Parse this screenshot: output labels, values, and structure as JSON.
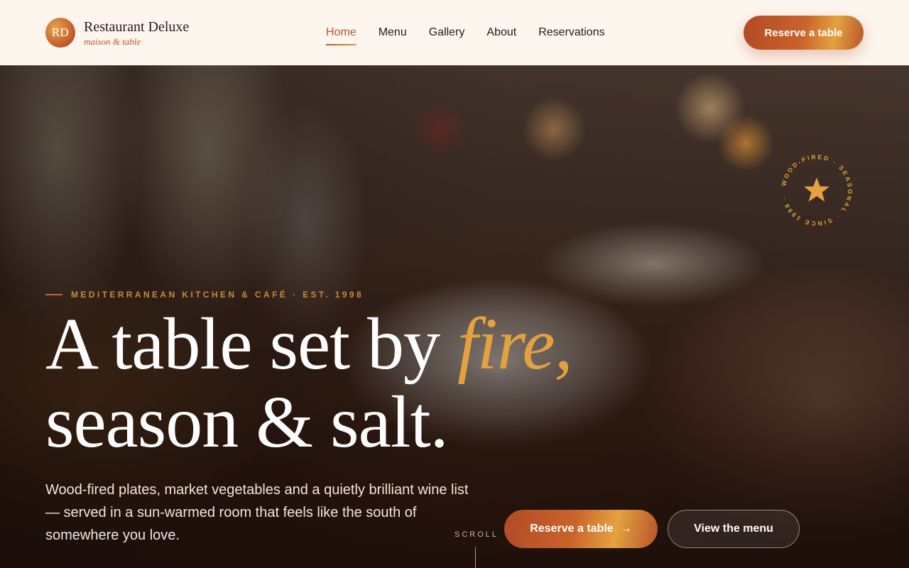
{
  "brand": {
    "monogram": "RD",
    "name": "Restaurant Deluxe",
    "tagline": "maison & table"
  },
  "nav": {
    "items": [
      {
        "label": "Home",
        "active": true
      },
      {
        "label": "Menu",
        "active": false
      },
      {
        "label": "Gallery",
        "active": false
      },
      {
        "label": "About",
        "active": false
      },
      {
        "label": "Reservations",
        "active": false
      }
    ],
    "cta_label": "Reserve a table"
  },
  "hero": {
    "eyebrow": "MEDITERRANEAN KITCHEN & CAFÉ · EST. 1998",
    "headline_part1": "A table set by ",
    "headline_accent": "fire,",
    "headline_part2": "season & salt.",
    "lede": "Wood-fired plates, market vegetables and a quietly brilliant wine list — served in a sun-warmed room that feels like the south of somewhere you love.",
    "primary_cta": "Reserve a table",
    "primary_cta_icon": "→",
    "secondary_cta": "View the menu",
    "scroll_label": "SCROLL"
  },
  "badge": {
    "ring_text": "WOOD-FIRED · SEASONAL · SINCE 1998 ·",
    "icon": "star-icon",
    "color": "#e3a23f"
  },
  "colors": {
    "accent": "#b9532a",
    "gold": "#e3a23f",
    "header_bg": "#fdf6ef"
  }
}
